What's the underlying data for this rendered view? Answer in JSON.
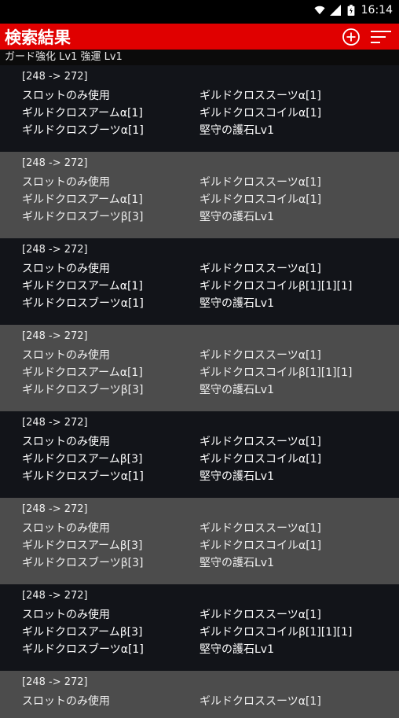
{
  "status": {
    "time": "16:14"
  },
  "appbar": {
    "title": "検索結果"
  },
  "summary": "ガード強化 Lv1  強運 Lv1",
  "results": [
    {
      "range": "[248 -> 272]",
      "items": [
        "スロットのみ使用",
        "ギルドクロススーツα[1]",
        "ギルドクロスアームα[1]",
        "ギルドクロスコイルα[1]",
        "ギルドクロスブーツα[1]",
        "堅守の護石Lv1"
      ]
    },
    {
      "range": "[248 -> 272]",
      "items": [
        "スロットのみ使用",
        "ギルドクロススーツα[1]",
        "ギルドクロスアームα[1]",
        "ギルドクロスコイルα[1]",
        "ギルドクロスブーツβ[3]",
        "堅守の護石Lv1"
      ]
    },
    {
      "range": "[248 -> 272]",
      "items": [
        "スロットのみ使用",
        "ギルドクロススーツα[1]",
        "ギルドクロスアームα[1]",
        "ギルドクロスコイルβ[1][1][1]",
        "ギルドクロスブーツα[1]",
        "堅守の護石Lv1"
      ]
    },
    {
      "range": "[248 -> 272]",
      "items": [
        "スロットのみ使用",
        "ギルドクロススーツα[1]",
        "ギルドクロスアームα[1]",
        "ギルドクロスコイルβ[1][1][1]",
        "ギルドクロスブーツβ[3]",
        "堅守の護石Lv1"
      ]
    },
    {
      "range": "[248 -> 272]",
      "items": [
        "スロットのみ使用",
        "ギルドクロススーツα[1]",
        "ギルドクロスアームβ[3]",
        "ギルドクロスコイルα[1]",
        "ギルドクロスブーツα[1]",
        "堅守の護石Lv1"
      ]
    },
    {
      "range": "[248 -> 272]",
      "items": [
        "スロットのみ使用",
        "ギルドクロススーツα[1]",
        "ギルドクロスアームβ[3]",
        "ギルドクロスコイルα[1]",
        "ギルドクロスブーツβ[3]",
        "堅守の護石Lv1"
      ]
    },
    {
      "range": "[248 -> 272]",
      "items": [
        "スロットのみ使用",
        "ギルドクロススーツα[1]",
        "ギルドクロスアームβ[3]",
        "ギルドクロスコイルβ[1][1][1]",
        "ギルドクロスブーツα[1]",
        "堅守の護石Lv1"
      ]
    },
    {
      "range": "[248 -> 272]",
      "items": [
        "スロットのみ使用",
        "ギルドクロススーツα[1]"
      ]
    }
  ]
}
